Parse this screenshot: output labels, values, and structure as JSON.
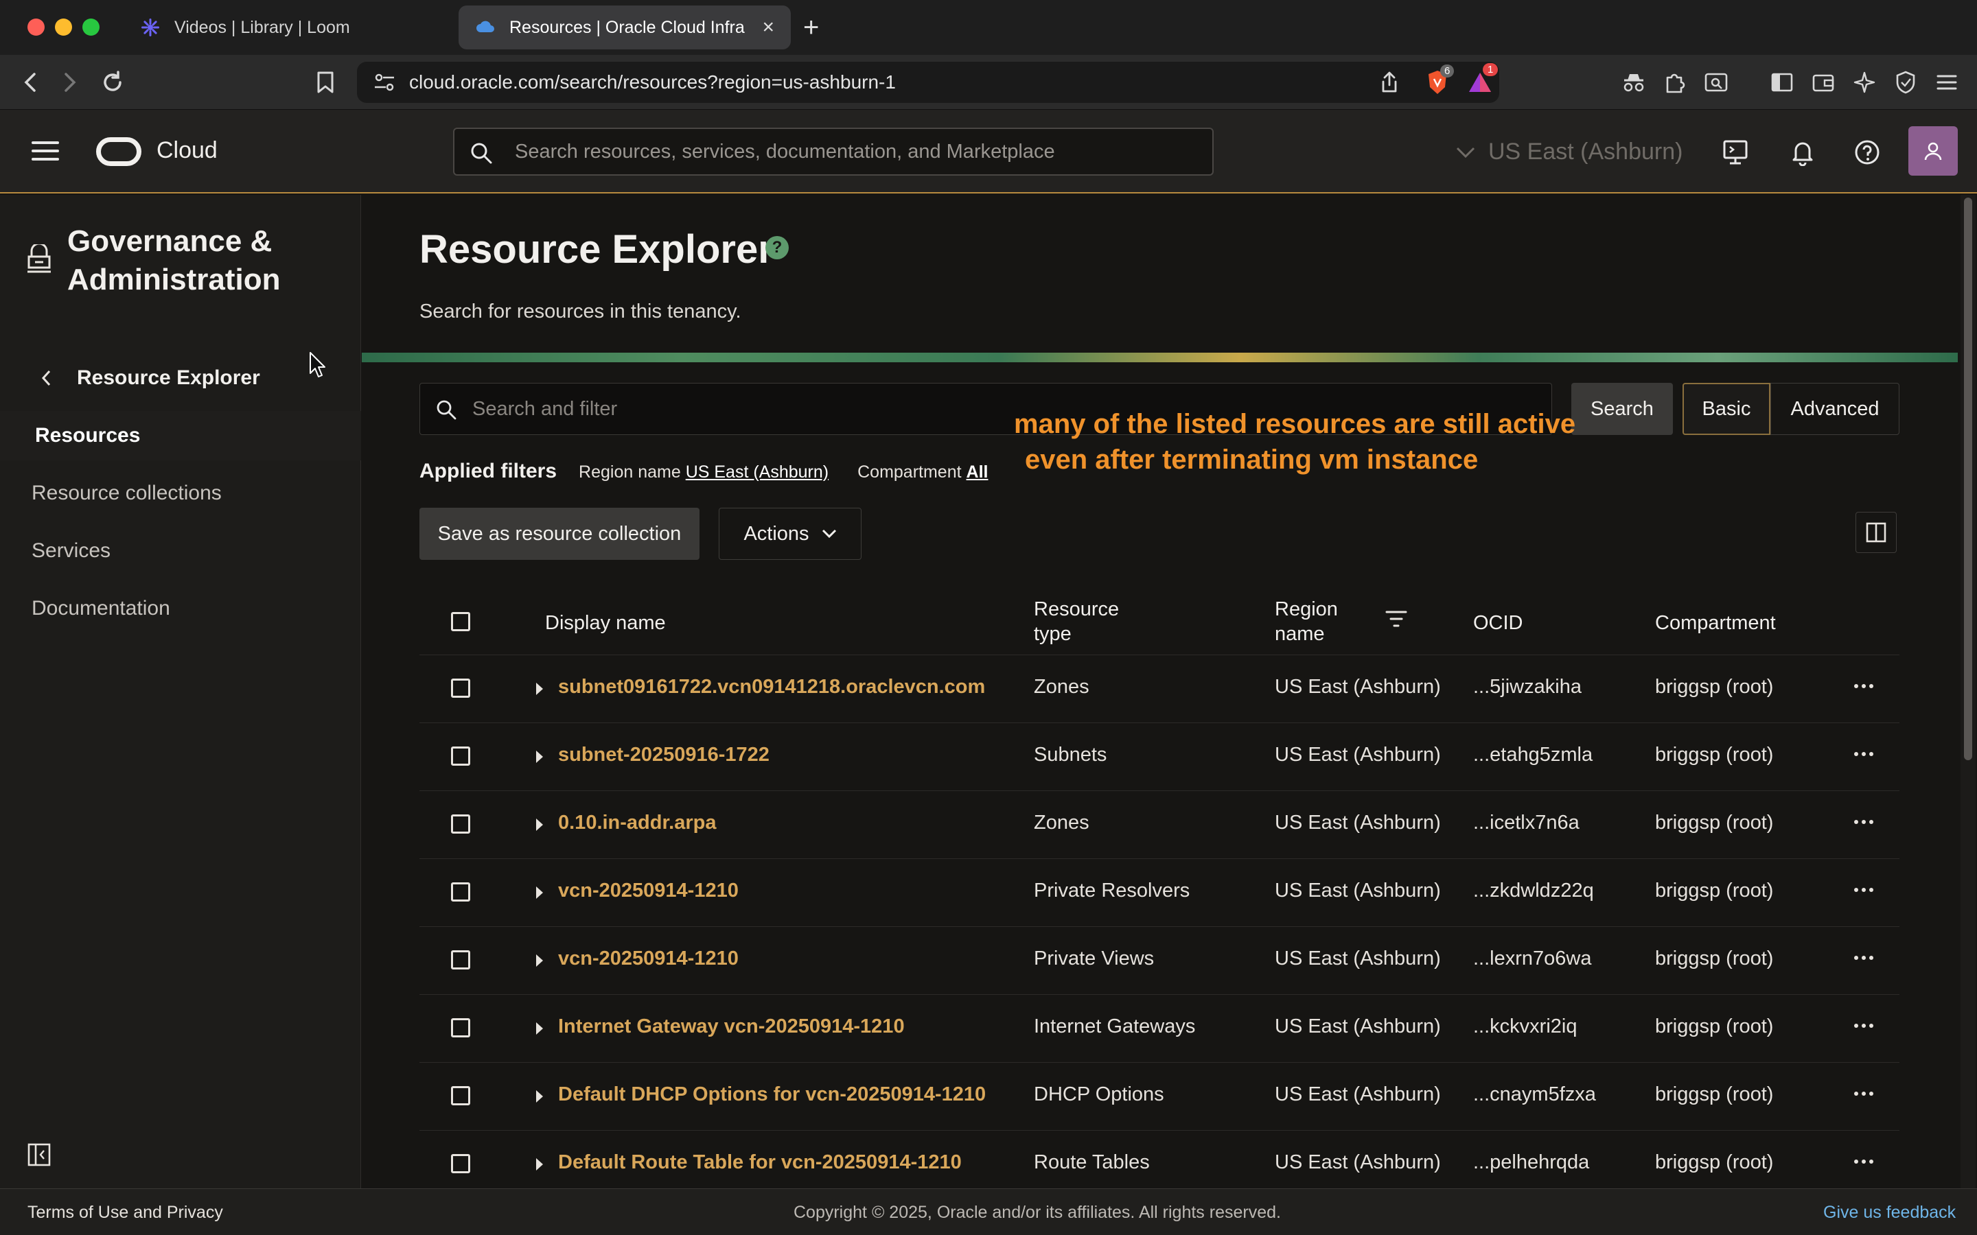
{
  "browser": {
    "tabs": [
      {
        "title": "Videos | Library | Loom",
        "active": false
      },
      {
        "title": "Resources | Oracle Cloud Infra",
        "active": true
      }
    ],
    "new_tab": "+",
    "url": "cloud.oracle.com/search/resources?region=us-ashburn-1",
    "badges": {
      "brave_shields": "6",
      "rewards": "1"
    }
  },
  "header": {
    "brand": "Cloud",
    "search_placeholder": "Search resources, services, documentation, and Marketplace",
    "region": "US East (Ashburn)"
  },
  "sidebar": {
    "section_title": "Governance & Administration",
    "back_label": "Resource Explorer",
    "items": [
      {
        "label": "Resources",
        "active": true
      },
      {
        "label": "Resource collections",
        "active": false
      },
      {
        "label": "Services",
        "active": false
      },
      {
        "label": "Documentation",
        "active": false
      }
    ]
  },
  "main": {
    "title": "Resource Explorer",
    "subtitle": "Search for resources in this tenancy.",
    "filter_placeholder": "Search and filter",
    "search_button": "Search",
    "mode_basic": "Basic",
    "mode_advanced": "Advanced",
    "annotation_line1": "many of the listed resources are still active",
    "annotation_line2": "even after terminating vm instance",
    "applied_filters_label": "Applied filters",
    "filters": [
      {
        "name": "Region name",
        "value": "US East (Ashburn)"
      },
      {
        "name": "Compartment",
        "value": "All"
      }
    ],
    "save_button": "Save as resource collection",
    "actions_button": "Actions",
    "columns": {
      "display_name": "Display name",
      "resource_type_1": "Resource",
      "resource_type_2": "type",
      "region_name_1": "Region",
      "region_name_2": "name",
      "ocid": "OCID",
      "compartment": "Compartment"
    },
    "rows": [
      {
        "name": "subnet09161722.vcn09141218.oraclevcn.com",
        "type": "Zones",
        "region": "US East (Ashburn)",
        "ocid": "...5jiwzakiha",
        "compartment": "briggsp (root)"
      },
      {
        "name": "subnet-20250916-1722",
        "type": "Subnets",
        "region": "US East (Ashburn)",
        "ocid": "...etahg5zmla",
        "compartment": "briggsp (root)"
      },
      {
        "name": "0.10.in-addr.arpa",
        "type": "Zones",
        "region": "US East (Ashburn)",
        "ocid": "...icetlx7n6a",
        "compartment": "briggsp (root)"
      },
      {
        "name": "vcn-20250914-1210",
        "type": "Private Resolvers",
        "region": "US East (Ashburn)",
        "ocid": "...zkdwldz22q",
        "compartment": "briggsp (root)"
      },
      {
        "name": "vcn-20250914-1210",
        "type": "Private Views",
        "region": "US East (Ashburn)",
        "ocid": "...lexrn7o6wa",
        "compartment": "briggsp (root)"
      },
      {
        "name": "Internet Gateway vcn-20250914-1210",
        "type": "Internet Gateways",
        "region": "US East (Ashburn)",
        "ocid": "...kckvxri2iq",
        "compartment": "briggsp (root)"
      },
      {
        "name": "Default DHCP Options for vcn-20250914-1210",
        "type": "DHCP Options",
        "region": "US East (Ashburn)",
        "ocid": "...cnaym5fzxa",
        "compartment": "briggsp (root)"
      },
      {
        "name": "Default Route Table for vcn-20250914-1210",
        "type": "Route Tables",
        "region": "US East (Ashburn)",
        "ocid": "...pelhehrqda",
        "compartment": "briggsp (root)"
      }
    ]
  },
  "footer": {
    "terms": "Terms of Use and Privacy",
    "copyright": "Copyright © 2025, Oracle and/or its affiliates. All rights reserved.",
    "feedback": "Give us feedback"
  },
  "colors": {
    "link": "#d9a75a",
    "annotation": "#f0922b",
    "accent_border": "#b78a3e",
    "feedback_link": "#6fb5e8"
  }
}
